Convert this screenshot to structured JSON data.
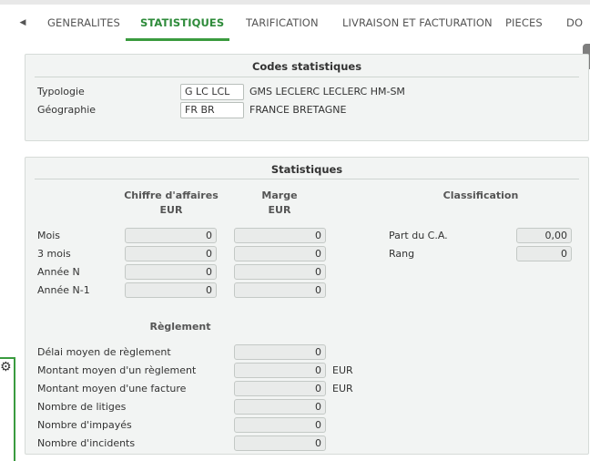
{
  "tabs": [
    {
      "label": "GENERALITES"
    },
    {
      "label": "STATISTIQUES"
    },
    {
      "label": "TARIFICATION"
    },
    {
      "label": "LIVRAISON ET FACTURATION"
    },
    {
      "label": "PIECES"
    },
    {
      "label": "DO"
    }
  ],
  "active_tab": "STATISTIQUES",
  "codes": {
    "title": "Codes statistiques",
    "typologie": {
      "label": "Typologie",
      "code": "G LC LCL",
      "description": "GMS LECLERC LECLERC HM-SM"
    },
    "geographie": {
      "label": "Géographie",
      "code": "FR BR",
      "description": "FRANCE BRETAGNE"
    }
  },
  "stats": {
    "title": "Statistiques",
    "col_ca": {
      "line1": "Chiffre d'affaires",
      "line2": "EUR"
    },
    "col_marge": {
      "line1": "Marge",
      "line2": "EUR"
    },
    "col_classification": "Classification",
    "rows": [
      {
        "label": "Mois",
        "ca": "0",
        "marge": "0"
      },
      {
        "label": "3 mois",
        "ca": "0",
        "marge": "0"
      },
      {
        "label": "Année N",
        "ca": "0",
        "marge": "0"
      },
      {
        "label": "Année N-1",
        "ca": "0",
        "marge": "0"
      }
    ],
    "classification": [
      {
        "label": "Part du C.A.",
        "value": "0,00"
      },
      {
        "label": "Rang",
        "value": "0"
      }
    ]
  },
  "reglement": {
    "title": "Règlement",
    "rows": [
      {
        "label": "Délai moyen de règlement",
        "value": "0",
        "unit": ""
      },
      {
        "label": "Montant moyen d'un règlement",
        "value": "0",
        "unit": "EUR"
      },
      {
        "label": "Montant moyen d'une facture",
        "value": "0",
        "unit": "EUR"
      },
      {
        "label": "Nombre de litiges",
        "value": "0",
        "unit": ""
      },
      {
        "label": "Nombre d'impayés",
        "value": "0",
        "unit": ""
      },
      {
        "label": "Nombre d'incidents",
        "value": "0",
        "unit": ""
      }
    ]
  },
  "colors": {
    "accent": "#3a9b3f",
    "panel_bg": "#f2f4f3",
    "field_bg": "#e9ebea"
  },
  "icons": {
    "tabs_left": "chevron-left-icon",
    "settings": "gear-icon"
  }
}
